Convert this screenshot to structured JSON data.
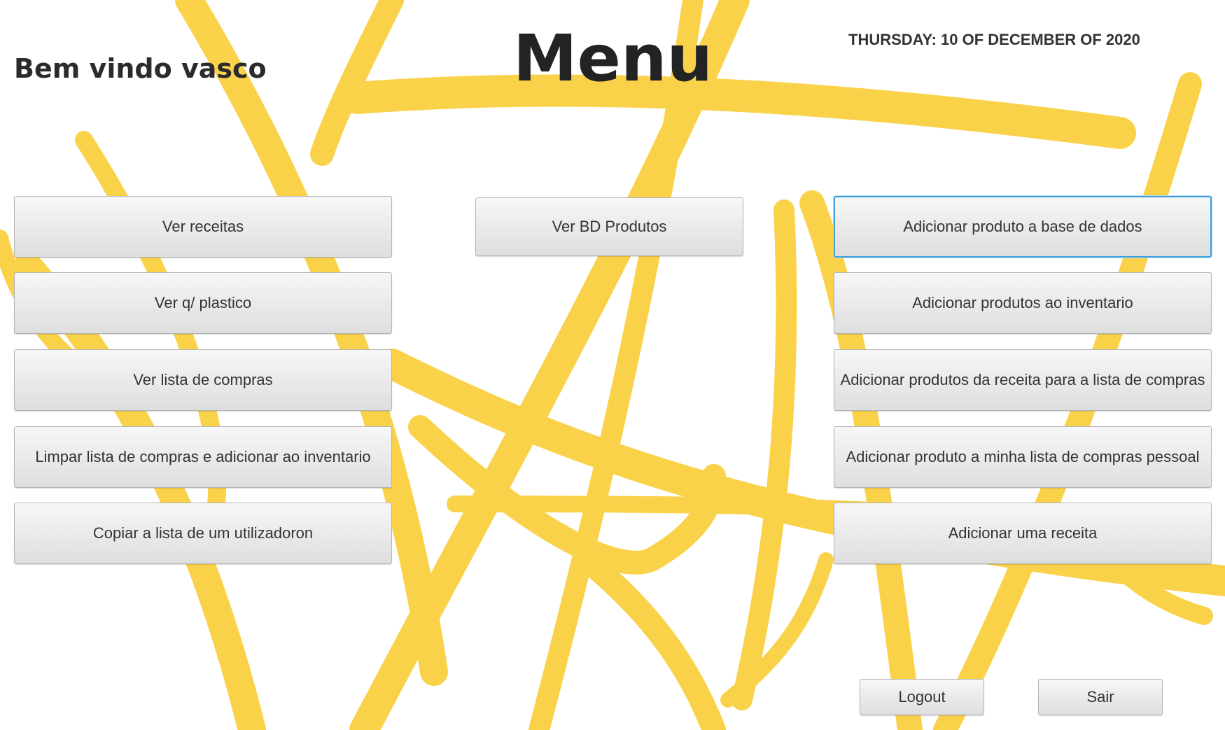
{
  "header": {
    "welcome": "Bem vindo vasco",
    "title": "Menu",
    "date": "THURSDAY: 10 OF DECEMBER OF 2020"
  },
  "left_buttons": [
    "Ver receitas",
    "Ver q/ plastico",
    "Ver lista de compras",
    "Limpar lista de compras e adicionar ao inventario",
    "Copiar a lista de um utilizadoron"
  ],
  "center_buttons": [
    "Ver BD Produtos"
  ],
  "right_buttons": [
    "Adicionar produto a base de dados",
    "Adicionar produtos ao inventario",
    "Adicionar produtos da receita para a lista de compras",
    "Adicionar produto a minha lista de compras pessoal",
    "Adicionar uma receita"
  ],
  "footer": {
    "logout": "Logout",
    "exit": "Sair"
  },
  "colors": {
    "accent_yellow": "#f9c81e",
    "focus_border": "#3f9fd6"
  }
}
